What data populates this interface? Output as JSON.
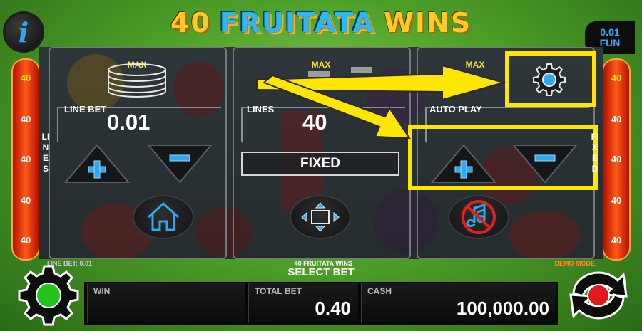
{
  "header": {
    "title_number": "40",
    "title_main": "FRUITATA",
    "title_wins": "WINS",
    "info_icon": "info-icon",
    "denomination": "0.01",
    "mode_label": "FUN"
  },
  "side": {
    "left_numbers": [
      "40",
      "40",
      "40",
      "40",
      "40"
    ],
    "right_numbers": [
      "40",
      "40",
      "40",
      "40",
      "40"
    ],
    "left_word": "LINES",
    "right_word": "FIXED"
  },
  "bet_panel": {
    "line_bet": {
      "max_label": "MAX",
      "label": "LINE BET",
      "value": "0.01"
    },
    "lines": {
      "max_label": "MAX",
      "label": "LINES",
      "value": "40",
      "fixed_label": "FIXED"
    },
    "auto_play": {
      "max_label": "MAX",
      "label": "AUTO PLAY"
    },
    "icons": {
      "coin_stack": "coin-stack-icon",
      "lines": "lines-icon",
      "home": "home-icon",
      "fullscreen": "fullscreen-icon",
      "sound_off": "sound-off-icon",
      "auto_settings": "gear-icon"
    }
  },
  "strip": {
    "line_bet_text": "LINE BET: 0.01",
    "game_name": "40 FRUITATA WINS",
    "mode_text": "DEMO MODE",
    "select_bet": "SELECT BET"
  },
  "bottom": {
    "win_label": "WIN",
    "win_value": "",
    "total_bet_label": "TOTAL BET",
    "total_bet_value": "0.40",
    "cash_label": "CASH",
    "cash_value": "100,000.00"
  },
  "colors": {
    "accent_blue": "#2ea8ee",
    "highlight_yellow": "#ffe600",
    "side_red": "#e0300a",
    "max_yellow": "#ffe62b",
    "demo_orange": "#ff8a1a"
  }
}
